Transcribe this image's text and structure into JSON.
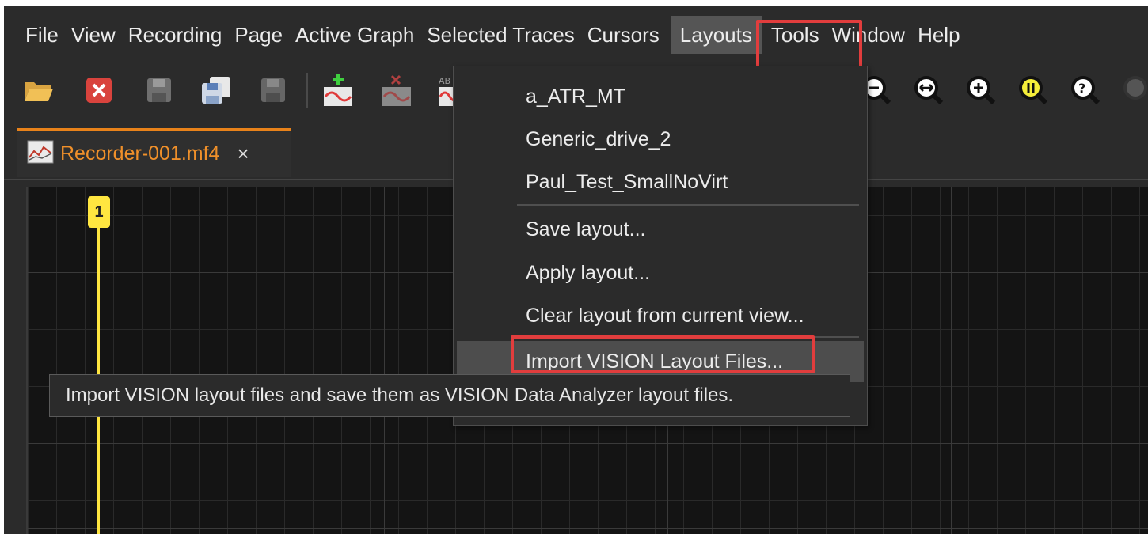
{
  "menubar": {
    "items": [
      "File",
      "View",
      "Recording",
      "Page",
      "Active Graph",
      "Selected Traces",
      "Cursors",
      "Layouts",
      "Tools",
      "Window",
      "Help"
    ],
    "active": "Layouts"
  },
  "toolbar": {
    "left_icons": [
      "open-folder-icon",
      "close-file-icon",
      "save-icon",
      "save-all-icon",
      "save-disabled-icon",
      "add-trace-icon",
      "remove-trace-icon",
      "trace-icon"
    ],
    "right_icons": [
      "zoom-out-icon",
      "zoom-horizontal-icon",
      "zoom-in-icon",
      "zoom-vertical-icon",
      "zoom-pause-icon",
      "zoom-query-icon"
    ],
    "trace_icon_label": "AB"
  },
  "tab": {
    "label": "Recorder-001.mf4",
    "close_glyph": "×"
  },
  "graph": {
    "cursor_label": "1",
    "cursor_color": "#ffe640"
  },
  "layouts_menu": {
    "layouts": [
      "a_ATR_MT",
      "Generic_drive_2",
      "Paul_Test_SmallNoVirt"
    ],
    "actions": [
      "Save layout...",
      "Apply layout...",
      "Clear layout from current view..."
    ],
    "import": "Import VISION Layout Files..."
  },
  "tooltip": {
    "text": "Import VISION layout files and save them as VISION Data Analyzer layout files."
  },
  "colors": {
    "highlight": "#e13d3d",
    "tab_accent": "#e8821a",
    "background": "#2b2b2b"
  }
}
